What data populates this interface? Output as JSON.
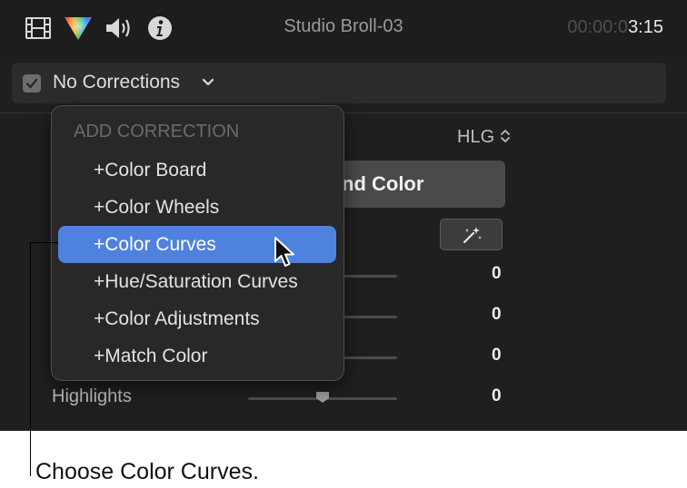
{
  "inspector": {
    "clip_title": "Studio Broll-03",
    "timecode": {
      "dim": "00:00:0",
      "bright": "3:15"
    },
    "icons": [
      "film-strip-icon",
      "color-prism-icon",
      "speaker-icon",
      "info-icon"
    ]
  },
  "corrections": {
    "checked": true,
    "selected_label": "No Corrections"
  },
  "background": {
    "color_space": "HLG",
    "match_color_label": "nd Color",
    "sliders": [
      {
        "label": "",
        "value": "0"
      },
      {
        "label": "",
        "value": "0"
      },
      {
        "label": "",
        "value": "0"
      },
      {
        "label": "Highlights",
        "value": "0"
      }
    ]
  },
  "menu": {
    "header": "ADD CORRECTION",
    "items": [
      {
        "label": "+Color Board",
        "selected": false
      },
      {
        "label": "+Color Wheels",
        "selected": false
      },
      {
        "label": "+Color Curves",
        "selected": true
      },
      {
        "label": "+Hue/Saturation Curves",
        "selected": false
      },
      {
        "label": "+Color Adjustments",
        "selected": false
      },
      {
        "label": "+Match Color",
        "selected": false
      }
    ]
  },
  "callout": "Choose Color Curves.",
  "colors": {
    "accent": "#4f82de",
    "panel": "#1f1f1f",
    "menu": "#282828"
  }
}
